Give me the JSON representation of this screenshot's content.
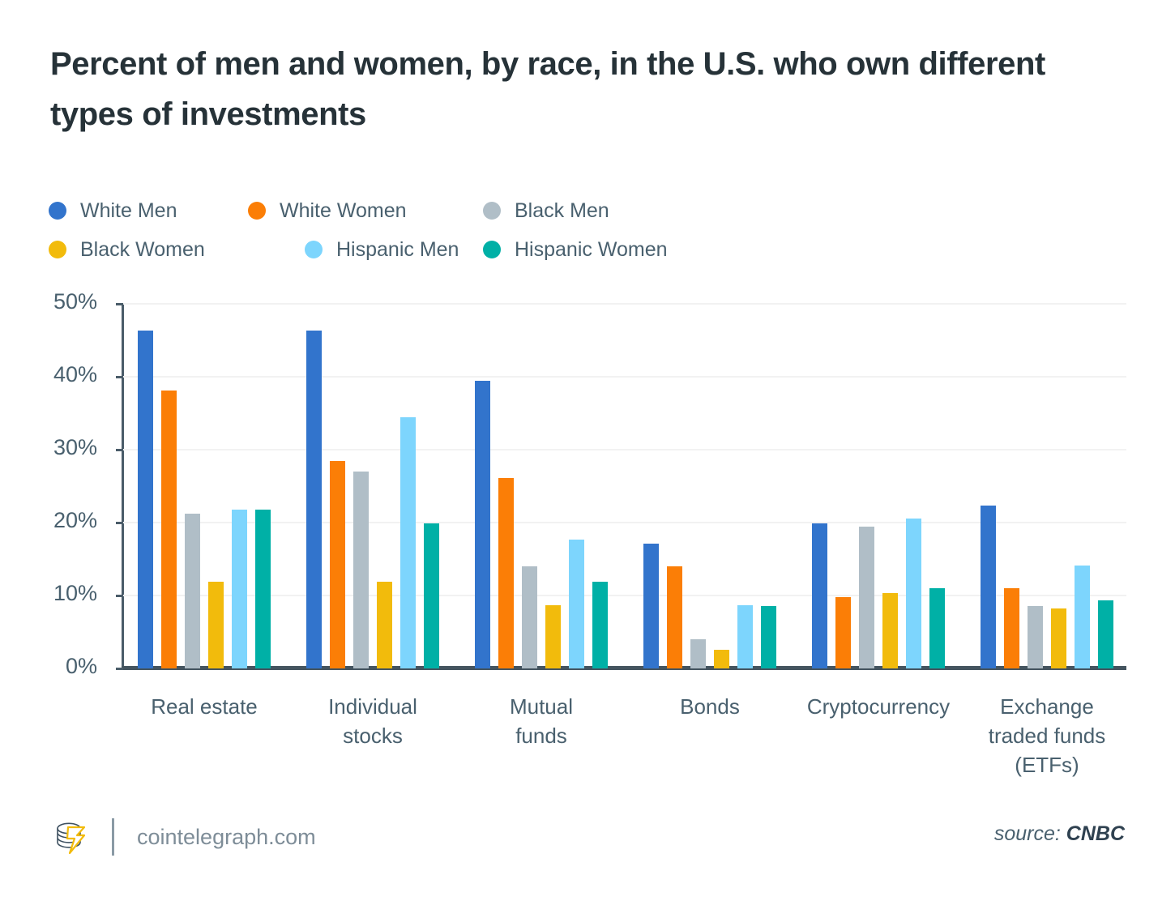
{
  "title": "Percent of men and women, by race, in the U.S. who own different types of investments",
  "footer": {
    "logo_icon": "cointelegraph-coin-stack-lightning-logo",
    "site": "cointelegraph.com",
    "source_prefix": "source:",
    "source_name": "CNBC"
  },
  "chart_data": {
    "type": "bar",
    "title": "Percent of men and women, by race, in the U.S. who own different types of investments",
    "xlabel": "",
    "ylabel": "",
    "ylim": [
      0,
      50
    ],
    "yticks": [
      0,
      10,
      20,
      30,
      40,
      50
    ],
    "ytick_labels": [
      "0%",
      "10%",
      "20%",
      "30%",
      "40%",
      "50%"
    ],
    "grid": true,
    "legend_position": "top-left",
    "unit": "%",
    "categories": [
      "Real estate",
      "Individual stocks",
      "Mutual funds",
      "Bonds",
      "Cryptocurrency",
      "Exchange traded funds (ETFs)"
    ],
    "category_label_lines": [
      [
        "Real estate"
      ],
      [
        "Individual",
        "stocks"
      ],
      [
        "Mutual",
        "funds"
      ],
      [
        "Bonds"
      ],
      [
        "Cryptocurrency"
      ],
      [
        "Exchange",
        "traded funds",
        "(ETFs)"
      ]
    ],
    "series": [
      {
        "name": "White Men",
        "color": "#3274cc",
        "values": [
          46.3,
          46.3,
          39.4,
          17.1,
          19.9,
          22.3
        ]
      },
      {
        "name": "White Women",
        "color": "#fb7e06",
        "values": [
          38.1,
          28.5,
          26.1,
          14.0,
          9.8,
          11.0
        ]
      },
      {
        "name": "Black Men",
        "color": "#b0bec7",
        "values": [
          21.2,
          27.0,
          14.0,
          4.0,
          19.5,
          8.6
        ]
      },
      {
        "name": "Black Women",
        "color": "#f2bb0c",
        "values": [
          11.9,
          11.9,
          8.7,
          2.6,
          10.3,
          8.2
        ]
      },
      {
        "name": "Hispanic Men",
        "color": "#7dd5fd",
        "values": [
          21.8,
          34.4,
          17.7,
          8.7,
          20.6,
          14.1
        ]
      },
      {
        "name": "Hispanic Women",
        "color": "#00b0a6",
        "values": [
          21.8,
          19.9,
          11.9,
          8.6,
          11.0,
          9.3
        ]
      }
    ]
  }
}
